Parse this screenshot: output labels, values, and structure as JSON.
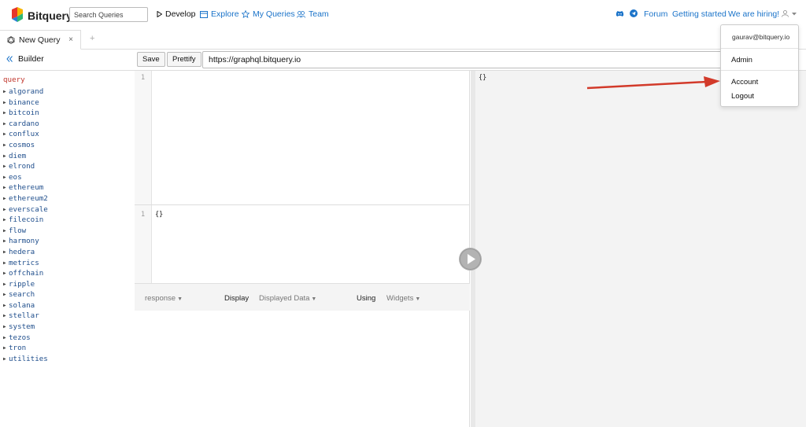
{
  "header": {
    "brand": "Bitquery",
    "search_placeholder": "Search Queries",
    "nav": [
      {
        "label": "Develop",
        "icon": "play-triangle-icon"
      },
      {
        "label": "Explore",
        "icon": "explore-window-icon"
      },
      {
        "label": "My Queries",
        "icon": "star-icon"
      },
      {
        "label": "Team",
        "icon": "team-icon"
      }
    ],
    "right": {
      "discord_icon": "discord-icon",
      "telegram_icon": "telegram-icon",
      "forum": "Forum",
      "getting_started": "Getting started",
      "hiring": "We are hiring!",
      "user_icon": "user-icon"
    }
  },
  "tabs": [
    {
      "label": "New Query",
      "icon": "graphql-icon",
      "close": "×"
    }
  ],
  "tab_add": "+",
  "builder": {
    "label": "Builder",
    "icon": "double-chevron-left-icon"
  },
  "toolbar": {
    "save": "Save",
    "prettify": "Prettify",
    "url": "https://graphql.bitquery.io"
  },
  "schema_tree": {
    "root": "query",
    "items": [
      "algorand",
      "binance",
      "bitcoin",
      "cardano",
      "conflux",
      "cosmos",
      "diem",
      "elrond",
      "eos",
      "ethereum",
      "ethereum2",
      "everscale",
      "filecoin",
      "flow",
      "harmony",
      "hedera",
      "metrics",
      "offchain",
      "ripple",
      "search",
      "solana",
      "stellar",
      "system",
      "tezos",
      "tron",
      "utilities"
    ]
  },
  "query_editor": {
    "line": "1",
    "content": ""
  },
  "variables_editor": {
    "line": "1",
    "content": "{}"
  },
  "bottom_bar": {
    "response": "response",
    "display": "Display",
    "displayed_data": "Displayed Data",
    "using": "Using",
    "widgets": "Widgets"
  },
  "result": {
    "content": "{}"
  },
  "user_menu": {
    "email": "gaurav@bitquery.io",
    "items": [
      "Admin",
      "Account",
      "Logout"
    ]
  },
  "colors": {
    "link": "#1a73c9",
    "annotation_arrow": "#d23a2a",
    "tree_item": "#1f4e8c",
    "tree_root": "#c0362c"
  }
}
